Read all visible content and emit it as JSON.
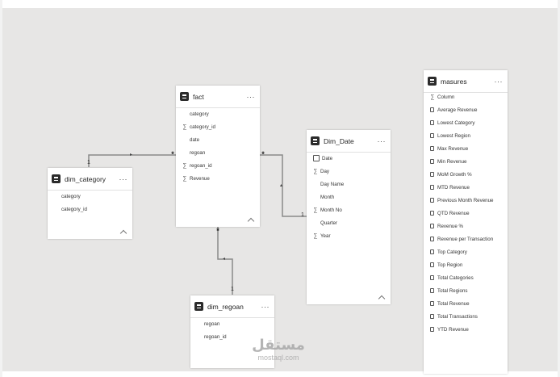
{
  "tables": {
    "fact": {
      "title": "fact",
      "more": "···",
      "columns": [
        {
          "icon": "none",
          "label": "category"
        },
        {
          "icon": "sigma",
          "label": "category_id"
        },
        {
          "icon": "none",
          "label": "date"
        },
        {
          "icon": "none",
          "label": "regoan"
        },
        {
          "icon": "sigma",
          "label": "regoan_id"
        },
        {
          "icon": "sigma",
          "label": "Revenue"
        }
      ]
    },
    "dim_category": {
      "title": "dim_category",
      "more": "···",
      "columns": [
        {
          "icon": "none",
          "label": "category"
        },
        {
          "icon": "none",
          "label": "category_id"
        }
      ]
    },
    "dim_date": {
      "title": "Dim_Date",
      "more": "···",
      "columns": [
        {
          "icon": "calendar",
          "label": "Date"
        },
        {
          "icon": "sigma",
          "label": "Day"
        },
        {
          "icon": "none",
          "label": "Day Name"
        },
        {
          "icon": "none",
          "label": "Month"
        },
        {
          "icon": "sigma",
          "label": "Month No"
        },
        {
          "icon": "none",
          "label": "Quarter"
        },
        {
          "icon": "sigma",
          "label": "Year"
        }
      ]
    },
    "dim_regoan": {
      "title": "dim_regoan",
      "more": "···",
      "columns": [
        {
          "icon": "none",
          "label": "regoan"
        },
        {
          "icon": "none",
          "label": "regoan_id"
        }
      ]
    },
    "masures": {
      "title": "masures",
      "more": "···",
      "columns": [
        {
          "icon": "sigma",
          "label": "Column"
        },
        {
          "icon": "measure",
          "label": "Average Revenue"
        },
        {
          "icon": "measure",
          "label": "Lowest Category"
        },
        {
          "icon": "measure",
          "label": "Lowest Region"
        },
        {
          "icon": "measure",
          "label": "Max Revenue"
        },
        {
          "icon": "measure",
          "label": "Min Revenue"
        },
        {
          "icon": "measure",
          "label": "MoM Growth %"
        },
        {
          "icon": "measure",
          "label": "MTD Revenue"
        },
        {
          "icon": "measure",
          "label": "Previous Month Revenue"
        },
        {
          "icon": "measure",
          "label": "QTD Revenue"
        },
        {
          "icon": "measure",
          "label": "Revenue %"
        },
        {
          "icon": "measure",
          "label": "Revenue per Transaction"
        },
        {
          "icon": "measure",
          "label": "Top Category"
        },
        {
          "icon": "measure",
          "label": "Top Region"
        },
        {
          "icon": "measure",
          "label": "Total Categories"
        },
        {
          "icon": "measure",
          "label": "Total Regions"
        },
        {
          "icon": "measure",
          "label": "Total Revenue"
        },
        {
          "icon": "measure",
          "label": "Total Transactions"
        },
        {
          "icon": "measure",
          "label": "YTD Revenue"
        }
      ]
    }
  },
  "relationships": {
    "cat_many": "*",
    "cat_one": "1",
    "date_many": "*",
    "date_one": "1",
    "reg_many": "*",
    "reg_one": "1"
  },
  "watermark": {
    "main": "مستقل",
    "sub": "mostaql.com"
  }
}
